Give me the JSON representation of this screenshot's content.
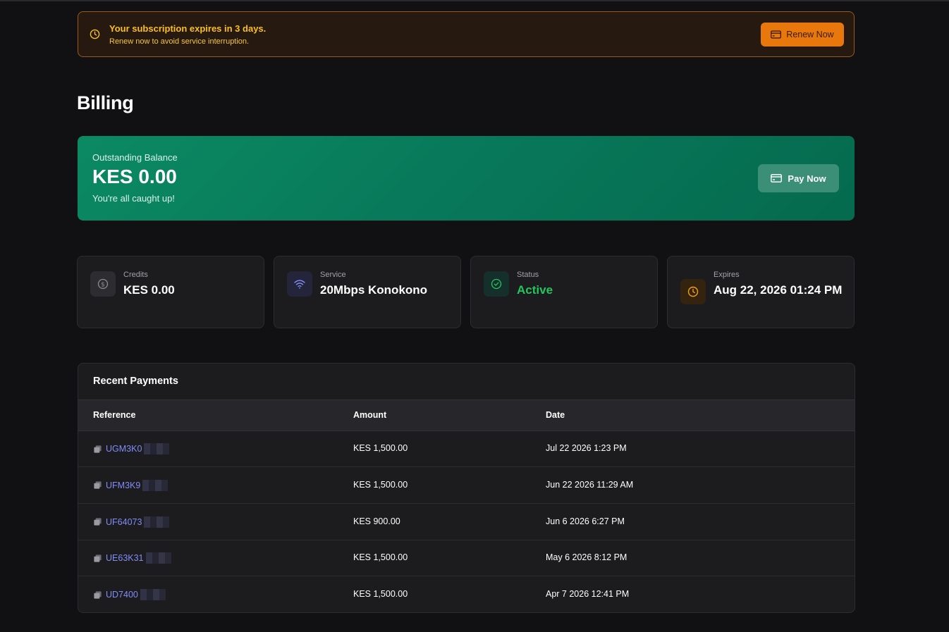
{
  "banner": {
    "title": "Your subscription expires in 3 days.",
    "subtitle": "Renew now to avoid service interruption.",
    "renew_label": "Renew Now"
  },
  "page": {
    "title": "Billing"
  },
  "balance": {
    "label": "Outstanding Balance",
    "value": "KES 0.00",
    "note": "You're all caught up!",
    "pay_label": "Pay Now"
  },
  "stats": {
    "credits": {
      "label": "Credits",
      "value": "KES 0.00",
      "icon": "dollar-icon"
    },
    "service": {
      "label": "Service",
      "value": "20Mbps Konokono",
      "icon": "wifi-icon"
    },
    "status": {
      "label": "Status",
      "value": "Active",
      "icon": "check-circle-icon",
      "color": "#22c55e"
    },
    "expires": {
      "label": "Expires",
      "value": "Aug 22, 2026 01:24 PM",
      "icon": "clock-icon"
    }
  },
  "payments": {
    "title": "Recent Payments",
    "columns": [
      "Reference",
      "Amount",
      "Date"
    ],
    "rows": [
      {
        "reference": "UGM3K0",
        "amount": "KES 1,500.00",
        "date": "Jul 22 2026 1:23 PM"
      },
      {
        "reference": "UFM3K9",
        "amount": "KES 1,500.00",
        "date": "Jun 22 2026 11:29 AM"
      },
      {
        "reference": "UF64073",
        "amount": "KES 900.00",
        "date": "Jun 6 2026 6:27 PM"
      },
      {
        "reference": "UE63K31",
        "amount": "KES 1,500.00",
        "date": "May 6 2026 8:12 PM"
      },
      {
        "reference": "UD7400",
        "amount": "KES 1,500.00",
        "date": "Apr 7 2026 12:41 PM"
      }
    ]
  },
  "colors": {
    "accent_orange": "#e8780c",
    "balance_green": "#0b8a62",
    "link": "#818cf8",
    "active": "#22c55e",
    "warning_text": "#fbbf24"
  }
}
